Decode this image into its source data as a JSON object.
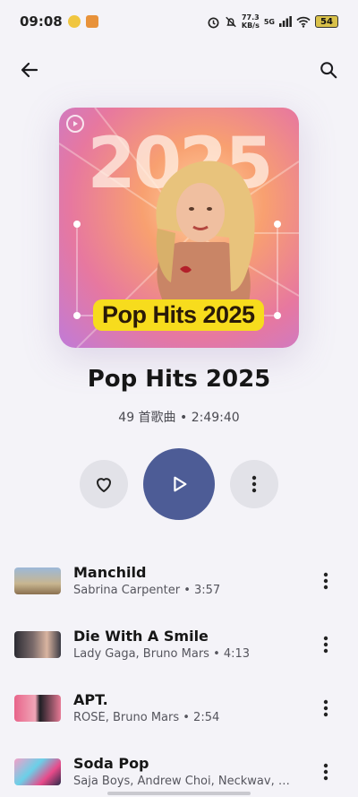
{
  "status_bar": {
    "time": "09:08",
    "speed_value": "77.3",
    "speed_unit": "KB/s",
    "network": "5G",
    "battery": "54"
  },
  "nav": {
    "back_icon": "arrow-left-icon",
    "search_icon": "search-icon"
  },
  "cover": {
    "year_text": "2025",
    "tag_text": "Pop Hits 2025"
  },
  "playlist": {
    "title": "Pop Hits 2025",
    "subtitle": "49 首歌曲 • 2:49:40"
  },
  "actions": {
    "like_icon": "heart-icon",
    "play_icon": "play-icon",
    "more_icon": "more-vertical-icon"
  },
  "tracks": [
    {
      "title": "Manchild",
      "subtitle": "Sabrina Carpenter • 3:57"
    },
    {
      "title": "Die With A Smile",
      "subtitle": "Lady Gaga, Bruno Mars • 4:13"
    },
    {
      "title": "APT.",
      "subtitle": "ROSÉ, Bruno Mars • 2:54"
    },
    {
      "title": "Soda Pop",
      "subtitle": "Saja Boys, Andrew Choi, Neckwav, …"
    }
  ],
  "colors": {
    "play_button": "#4d5c96",
    "round_button": "#e2e2e8",
    "background": "#f4f3f8"
  }
}
